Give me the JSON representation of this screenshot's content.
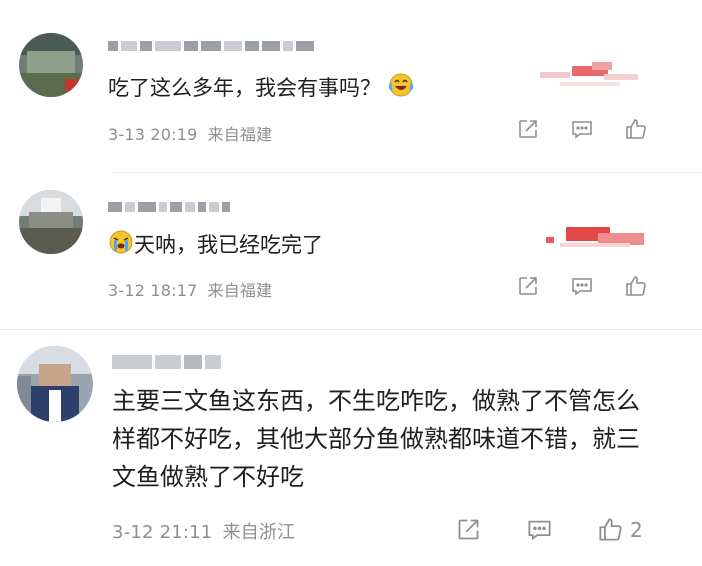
{
  "comments": [
    {
      "text": "吃了这么多年，我会有事吗？",
      "emoji": "laughing-crying-face",
      "date": "3-13 20:19",
      "location": "来自福建",
      "likes": ""
    },
    {
      "text": "天呐，我已经吃完了",
      "emoji": "crying-face",
      "date": "3-12 18:17",
      "location": "来自福建",
      "likes": ""
    },
    {
      "text": "主要三文鱼这东西，不生吃咋吃，做熟了不管怎么样都不好吃，其他大部分鱼做熟都味道不错，就三文鱼做熟了不好吃",
      "date": "3-12 21:11",
      "location": "来自浙江",
      "likes": "2"
    }
  ],
  "icons": [
    "share-icon",
    "reply-icon",
    "like-icon"
  ],
  "colors": {
    "meta": "#8f8f8f",
    "text": "#1f1f1f",
    "icon": "#8f8f8f"
  }
}
